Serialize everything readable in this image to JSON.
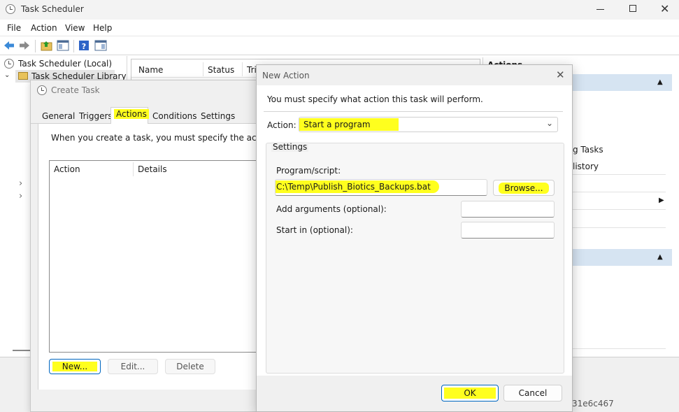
{
  "main_window": {
    "title": "Task Scheduler",
    "menu": [
      "File",
      "Action",
      "View",
      "Help"
    ],
    "tree": {
      "root": "Task Scheduler (Local)",
      "library": "Task Scheduler Library"
    },
    "columns": {
      "name": "Name",
      "status": "Status",
      "triggers": "Tri"
    },
    "actions_panel": {
      "header": "Actions",
      "item_1": "g Tasks",
      "item_2": "listory"
    },
    "status_text": "31e6c467"
  },
  "create_task": {
    "title": "Create Task",
    "tabs": [
      "General",
      "Triggers",
      "Actions",
      "Conditions",
      "Settings"
    ],
    "active_tab": "Actions",
    "description": "When you create a task, you must specify the action tha",
    "table": {
      "col_action": "Action",
      "col_details": "Details"
    },
    "buttons": {
      "new": "New...",
      "edit": "Edit...",
      "delete": "Delete"
    }
  },
  "new_action": {
    "title": "New Action",
    "prompt": "You must specify what action this task will perform.",
    "action_label": "Action:",
    "action_value": "Start a program",
    "settings_label": "Settings",
    "program_label": "Program/script:",
    "program_value": "C:\\Temp\\Publish_Biotics_Backups.bat",
    "browse_label": "Browse...",
    "args_label": "Add arguments (optional):",
    "args_value": "",
    "startin_label": "Start in (optional):",
    "startin_value": "",
    "ok_label": "OK",
    "cancel_label": "Cancel"
  },
  "colors": {
    "highlight": "#ffff1e",
    "accent": "#0067c0"
  }
}
